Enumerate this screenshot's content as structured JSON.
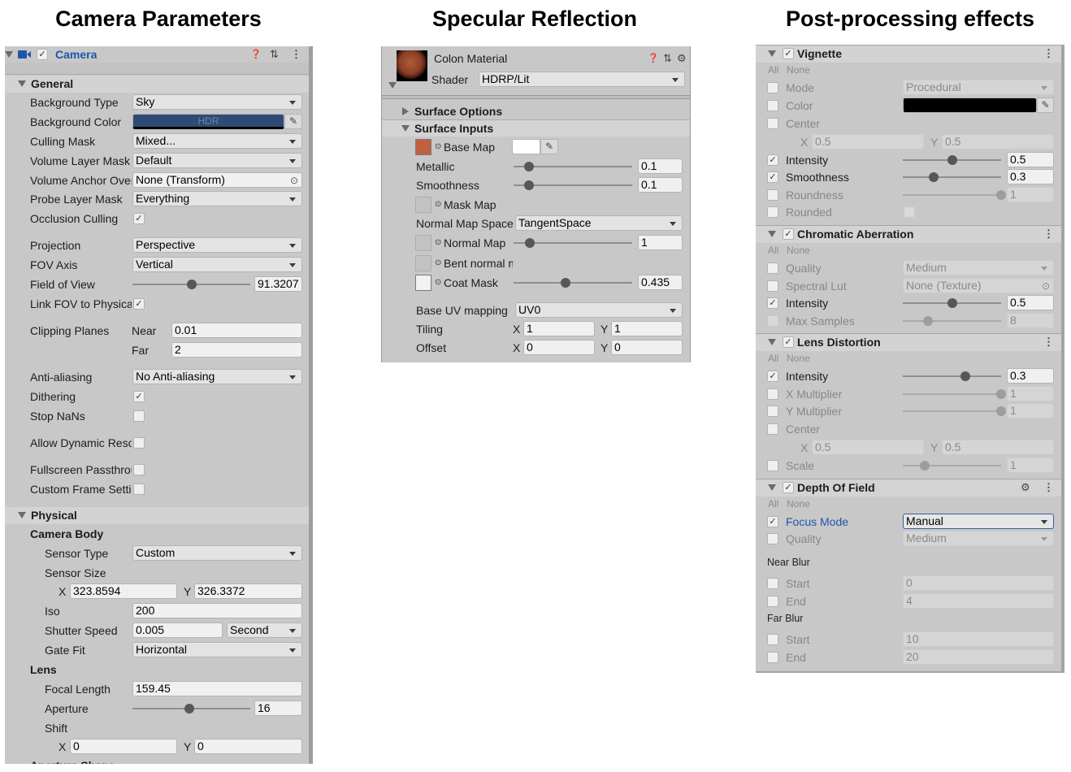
{
  "titles": [
    "Camera Parameters",
    "Specular Reflection",
    "Post-processing effects"
  ],
  "camera": {
    "component": "Camera",
    "enabled": true,
    "header_icons": [
      "help-icon",
      "preset-icon",
      "more-icon"
    ],
    "accent": "#1f56a8",
    "rows": [
      {
        "kind": "section",
        "label": "General",
        "expanded": true
      },
      {
        "kind": "dropdown",
        "label": "Background Type",
        "value": "Sky"
      },
      {
        "kind": "color",
        "label": "Background Color",
        "color": "#2f4a74",
        "text": "HDR"
      },
      {
        "kind": "dropdown",
        "label": "Culling Mask",
        "value": "Mixed..."
      },
      {
        "kind": "dropdown",
        "label": "Volume Layer Mask",
        "value": "Default"
      },
      {
        "kind": "object",
        "label": "Volume Anchor Override",
        "value": "None (Transform)"
      },
      {
        "kind": "dropdown",
        "label": "Probe Layer Mask",
        "value": "Everything"
      },
      {
        "kind": "check",
        "label": "Occlusion Culling",
        "checked": true
      },
      {
        "kind": "dropdown",
        "label": "Projection",
        "value": "Perspective"
      },
      {
        "kind": "dropdown",
        "label": "FOV Axis",
        "value": "Vertical"
      },
      {
        "kind": "slider",
        "label": "Field of View",
        "value": "91.3207",
        "position": 0.5
      },
      {
        "kind": "check",
        "label": "Link FOV to Physical Camera",
        "checked": true
      },
      {
        "kind": "clip",
        "label": "Clipping Planes",
        "sublabel": "Near",
        "value": "0.01"
      },
      {
        "kind": "clip",
        "label": "",
        "sublabel": "Far",
        "value": "2"
      },
      {
        "kind": "dropdown",
        "label": "Anti-aliasing",
        "value": "No Anti-aliasing"
      },
      {
        "kind": "check",
        "label": "Dithering",
        "checked": true
      },
      {
        "kind": "check",
        "label": "Stop NaNs",
        "checked": false
      },
      {
        "kind": "check",
        "label": "Allow Dynamic Resolution",
        "checked": false
      },
      {
        "kind": "check",
        "label": "Fullscreen Passthrough",
        "checked": false
      },
      {
        "kind": "check",
        "label": "Custom Frame Settings",
        "checked": false
      },
      {
        "kind": "section",
        "label": "Physical",
        "expanded": true
      },
      {
        "kind": "heading",
        "label": "Camera Body"
      },
      {
        "kind": "dropdown",
        "label": "Sensor Type",
        "value": "Custom"
      },
      {
        "kind": "label",
        "label": "Sensor Size"
      },
      {
        "kind": "xy",
        "x": "323.8594",
        "y": "326.3372"
      },
      {
        "kind": "text",
        "label": "Iso",
        "value": "200"
      },
      {
        "kind": "dual",
        "label": "Shutter Speed",
        "value": "0.005",
        "unit": "Second"
      },
      {
        "kind": "dropdown",
        "label": "Gate Fit",
        "value": "Horizontal"
      },
      {
        "kind": "heading",
        "label": "Lens"
      },
      {
        "kind": "text",
        "label": "Focal Length",
        "value": "159.45"
      },
      {
        "kind": "slider",
        "label": "Aperture",
        "value": "16",
        "position": 0.48
      },
      {
        "kind": "label",
        "label": "Shift"
      },
      {
        "kind": "xy",
        "x": "0",
        "y": "0"
      },
      {
        "kind": "heading",
        "label": "Aperture Shape"
      }
    ]
  },
  "material": {
    "name": "Colon Material",
    "shader_label": "Shader",
    "shader": "HDRP/Lit",
    "header_icons": [
      "help-icon",
      "preset-icon",
      "gear-icon"
    ],
    "sections": [
      {
        "label": "Surface Options",
        "expanded": false
      },
      {
        "label": "Surface Inputs",
        "expanded": true
      }
    ],
    "rows": [
      {
        "kind": "tex-color",
        "label": "Base Map",
        "swatch": "#c0603f",
        "color": "#ffffff"
      },
      {
        "kind": "slider",
        "label": "Metallic",
        "value": "0.1",
        "position": 0.13
      },
      {
        "kind": "slider",
        "label": "Smoothness",
        "value": "0.1",
        "position": 0.13
      },
      {
        "kind": "tex",
        "label": "Mask Map"
      },
      {
        "kind": "dropdown",
        "label": "Normal Map Space",
        "value": "TangentSpace"
      },
      {
        "kind": "tex-slider",
        "label": "Normal Map",
        "value": "1",
        "position": 0.14
      },
      {
        "kind": "tex",
        "label": "Bent normal map"
      },
      {
        "kind": "tex-slider",
        "label": "Coat Mask",
        "value": "0.435",
        "position": 0.435,
        "swatch": "#f2f2f2"
      },
      {
        "kind": "dropdown",
        "label": "Base UV mapping",
        "value": "UV0"
      },
      {
        "kind": "xy",
        "label": "Tiling",
        "x": "1",
        "y": "1"
      },
      {
        "kind": "xy",
        "label": "Offset",
        "x": "0",
        "y": "0"
      }
    ]
  },
  "postprocess": {
    "all_label": "All",
    "none_label": "None",
    "effects": [
      {
        "name": "Vignette",
        "enabled": true,
        "rows": [
          {
            "kind": "dropdown",
            "label": "Mode",
            "override": false,
            "value": "Procedural"
          },
          {
            "kind": "color",
            "label": "Color",
            "override": false,
            "color": "#000000"
          },
          {
            "kind": "label",
            "label": "Center",
            "override": false
          },
          {
            "kind": "xy",
            "x": "0.5",
            "y": "0.5"
          },
          {
            "kind": "slider",
            "label": "Intensity",
            "override": true,
            "value": "0.5",
            "position": 0.5
          },
          {
            "kind": "slider",
            "label": "Smoothness",
            "override": true,
            "value": "0.3",
            "position": 0.31
          },
          {
            "kind": "slider",
            "label": "Roundness",
            "override": false,
            "value": "1",
            "position": 1
          },
          {
            "kind": "check",
            "label": "Rounded",
            "override": false,
            "checked": false
          }
        ]
      },
      {
        "name": "Chromatic Aberration",
        "enabled": true,
        "rows": [
          {
            "kind": "dropdown",
            "label": "Quality",
            "override": false,
            "value": "Medium"
          },
          {
            "kind": "object",
            "label": "Spectral Lut",
            "override": false,
            "value": "None (Texture)"
          },
          {
            "kind": "slider",
            "label": "Intensity",
            "override": true,
            "value": "0.5",
            "position": 0.5
          },
          {
            "kind": "slider",
            "label": "Max Samples",
            "override": false,
            "value": "8",
            "position": 0.26
          }
        ]
      },
      {
        "name": "Lens Distortion",
        "enabled": true,
        "rows": [
          {
            "kind": "slider",
            "label": "Intensity",
            "override": true,
            "value": "0.3",
            "position": 0.64
          },
          {
            "kind": "slider",
            "label": "X Multiplier",
            "override": false,
            "value": "1",
            "position": 1
          },
          {
            "kind": "slider",
            "label": "Y Multiplier",
            "override": false,
            "value": "1",
            "position": 1
          },
          {
            "kind": "label",
            "label": "Center",
            "override": false
          },
          {
            "kind": "xy",
            "x": "0.5",
            "y": "0.5"
          },
          {
            "kind": "slider",
            "label": "Scale",
            "override": false,
            "value": "1",
            "position": 0.22
          }
        ]
      },
      {
        "name": "Depth Of Field",
        "enabled": true,
        "rows": [
          {
            "kind": "dropdown",
            "label": "Focus Mode",
            "override": true,
            "value": "Manual",
            "focused": true
          },
          {
            "kind": "dropdown",
            "label": "Quality",
            "override": false,
            "value": "Medium"
          },
          {
            "kind": "heading",
            "label": "Near Blur"
          },
          {
            "kind": "field",
            "label": "Start",
            "override": false,
            "value": "0"
          },
          {
            "kind": "field",
            "label": "End",
            "override": false,
            "value": "4"
          },
          {
            "kind": "heading",
            "label": "Far Blur"
          },
          {
            "kind": "field",
            "label": "Start",
            "override": false,
            "value": "10"
          },
          {
            "kind": "field",
            "label": "End",
            "override": false,
            "value": "20"
          }
        ]
      }
    ]
  }
}
